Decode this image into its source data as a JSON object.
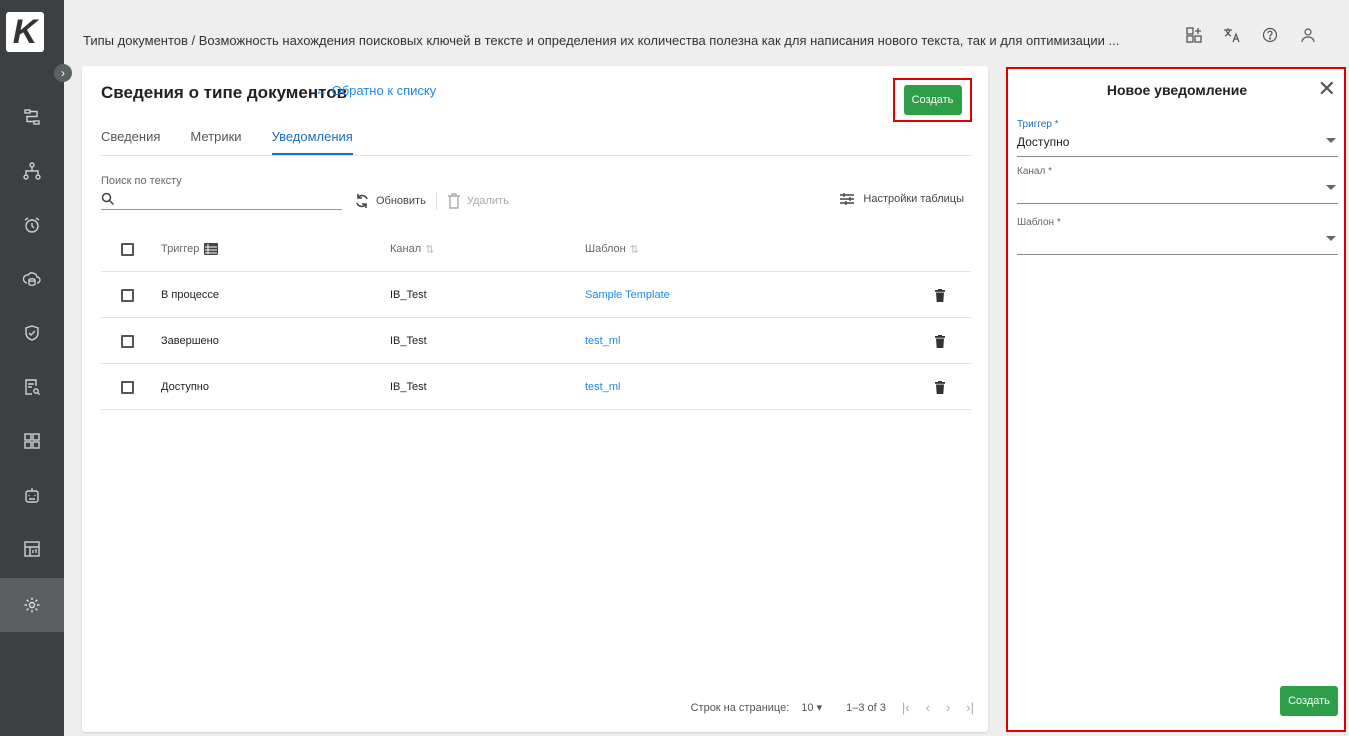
{
  "app": {
    "logo_letter": "K"
  },
  "sidebar": {
    "items": [
      {
        "icon": "flow-icon"
      },
      {
        "icon": "hierarchy-icon"
      },
      {
        "icon": "alarm-icon"
      },
      {
        "icon": "cloud-database-icon"
      },
      {
        "icon": "shield-check-icon"
      },
      {
        "icon": "document-search-icon"
      },
      {
        "icon": "dashboard-icon"
      },
      {
        "icon": "robot-icon"
      },
      {
        "icon": "calendar-chart-icon"
      },
      {
        "icon": "gear-icon",
        "active": true
      }
    ]
  },
  "header": {
    "breadcrumb": "Типы документов / Возможность нахождения поисковых ключей в тексте и определения их количества полезна как для написания нового текста, так и для оптимизации ..."
  },
  "main": {
    "title": "Сведения о типе документов",
    "back_link": "← Обратно к списку",
    "create_label": "Создать",
    "tabs": [
      {
        "label": "Сведения"
      },
      {
        "label": "Метрики"
      },
      {
        "label": "Уведомления",
        "active": true
      }
    ],
    "search": {
      "label": "Поиск по тексту",
      "value": ""
    },
    "toolbar": {
      "refresh": "Обновить",
      "delete": "Удалить",
      "table_settings": "Настройки таблицы"
    },
    "table": {
      "headers": {
        "trigger": "Триггер",
        "channel": "Канал",
        "template": "Шаблон"
      },
      "rows": [
        {
          "trigger": "В процессе",
          "channel": "IB_Test",
          "template": "Sample Template"
        },
        {
          "trigger": "Завершено",
          "channel": "IB_Test",
          "template": "test_ml"
        },
        {
          "trigger": "Доступно",
          "channel": "IB_Test",
          "template": "test_ml"
        }
      ]
    },
    "pagination": {
      "rows_label": "Строк на странице:",
      "rows_value": "10",
      "range": "1–3 of 3"
    }
  },
  "panel": {
    "title": "Новое уведомление",
    "fields": [
      {
        "label": "Триггер *",
        "value": "Доступно"
      },
      {
        "label": "Канал *",
        "value": ""
      },
      {
        "label": "Шаблон *",
        "value": ""
      }
    ],
    "create_label": "Создать"
  },
  "colors": {
    "accent": "#1e6fbf",
    "green": "#2e9e48",
    "highlight": "#e00000",
    "sidebar": "#3c4042"
  }
}
